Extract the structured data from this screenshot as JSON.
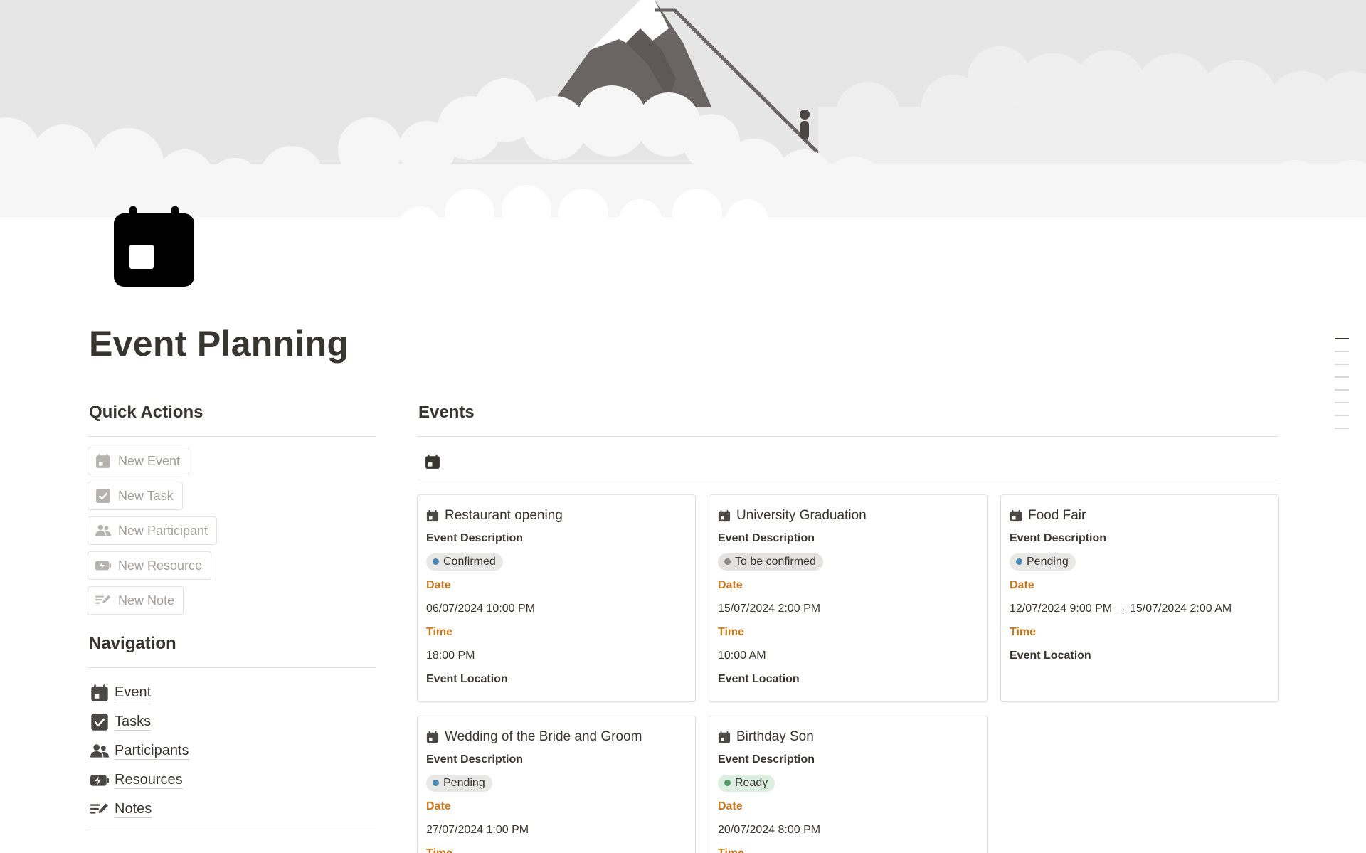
{
  "page": {
    "title": "Event Planning",
    "icon": "calendar-icon"
  },
  "quick_actions": {
    "heading": "Quick Actions",
    "buttons": [
      {
        "label": "New Event",
        "icon": "calendar-icon"
      },
      {
        "label": "New Task",
        "icon": "checkbox-icon"
      },
      {
        "label": "New Participant",
        "icon": "people-icon"
      },
      {
        "label": "New Resource",
        "icon": "battery-bolt-icon"
      },
      {
        "label": "New Note",
        "icon": "edit-lines-icon"
      }
    ]
  },
  "navigation": {
    "heading": "Navigation",
    "items": [
      {
        "label": "Event",
        "icon": "calendar-icon"
      },
      {
        "label": "Tasks",
        "icon": "checkbox-icon"
      },
      {
        "label": "Participants",
        "icon": "people-icon"
      },
      {
        "label": "Resources",
        "icon": "battery-bolt-icon"
      },
      {
        "label": "Notes",
        "icon": "edit-lines-icon"
      }
    ]
  },
  "events": {
    "heading": "Events",
    "view_icon": "calendar-icon",
    "labels": {
      "description": "Event Description",
      "date": "Date",
      "time": "Time",
      "location": "Event Location"
    },
    "cards": [
      {
        "title": "Restaurant opening",
        "status": "Confirmed",
        "status_color": "#4b88b8",
        "status_bg": "#e8e8e6",
        "date": "06/07/2024 10:00 PM",
        "time": "18:00 PM"
      },
      {
        "title": "University Graduation",
        "status": "To be confirmed",
        "status_color": "#8b8a86",
        "status_bg": "#e3e2e0",
        "date": "15/07/2024 2:00 PM",
        "time": "10:00 AM"
      },
      {
        "title": "Food Fair",
        "status": "Pending",
        "status_color": "#4b88b8",
        "status_bg": "#e8e8e6",
        "date": "12/07/2024 9:00 PM → 15/07/2024 2:00 AM",
        "time": ""
      },
      {
        "title": "Wedding of the Bride and Groom",
        "status": "Pending",
        "status_color": "#4b88b8",
        "status_bg": "#e8e8e6",
        "date": "27/07/2024 1:00 PM",
        "time": ""
      },
      {
        "title": "Birthday Son",
        "status": "Ready",
        "status_color": "#4f9a64",
        "status_bg": "#dcefe0",
        "date": "20/07/2024 8:00 PM",
        "time": ""
      }
    ]
  },
  "colors": {
    "accent_orange": "#c97a1f",
    "text": "#37352f",
    "muted": "#a09f9b",
    "cover_sky": "#e6e6e6",
    "cloud": "#f4f4f4",
    "mountain": "#6b6464"
  }
}
